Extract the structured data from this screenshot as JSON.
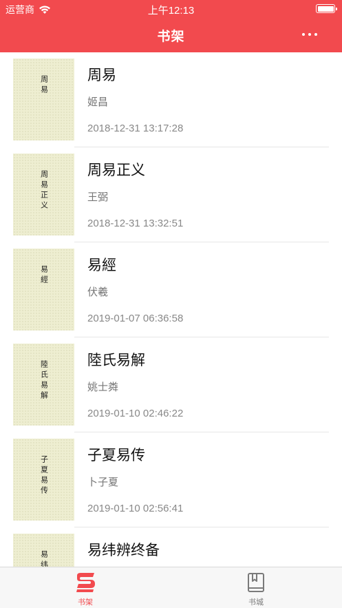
{
  "status_bar": {
    "carrier": "运营商",
    "time": "上午12:13"
  },
  "nav": {
    "title": "书架",
    "more_icon": "more-horizontal-icon"
  },
  "books": [
    {
      "cover_title": "周易",
      "title": "周易",
      "author": "姬昌",
      "date": "2018-12-31 13:17:28"
    },
    {
      "cover_title": "周易正义",
      "title": "周易正义",
      "author": "王弼",
      "date": "2018-12-31 13:32:51"
    },
    {
      "cover_title": "易經",
      "title": "易經",
      "author": "伏羲",
      "date": "2019-01-07 06:36:58"
    },
    {
      "cover_title": "陸氏易解",
      "title": "陸氏易解",
      "author": "姚士粦",
      "date": "2019-01-10 02:46:22"
    },
    {
      "cover_title": "子夏易传",
      "title": "子夏易传",
      "author": "卜子夏",
      "date": "2019-01-10 02:56:41"
    },
    {
      "cover_title": "易纬辨",
      "title": "易纬辨终备",
      "author": "",
      "date": ""
    }
  ],
  "tabbar": {
    "items": [
      {
        "label": "书架",
        "icon": "bookshelf-icon",
        "active": true
      },
      {
        "label": "书城",
        "icon": "book-icon",
        "active": false
      }
    ]
  },
  "colors": {
    "accent": "#f24a4e",
    "cover_bg": "#eeeed1",
    "inactive_tab": "#7a7a7a"
  }
}
